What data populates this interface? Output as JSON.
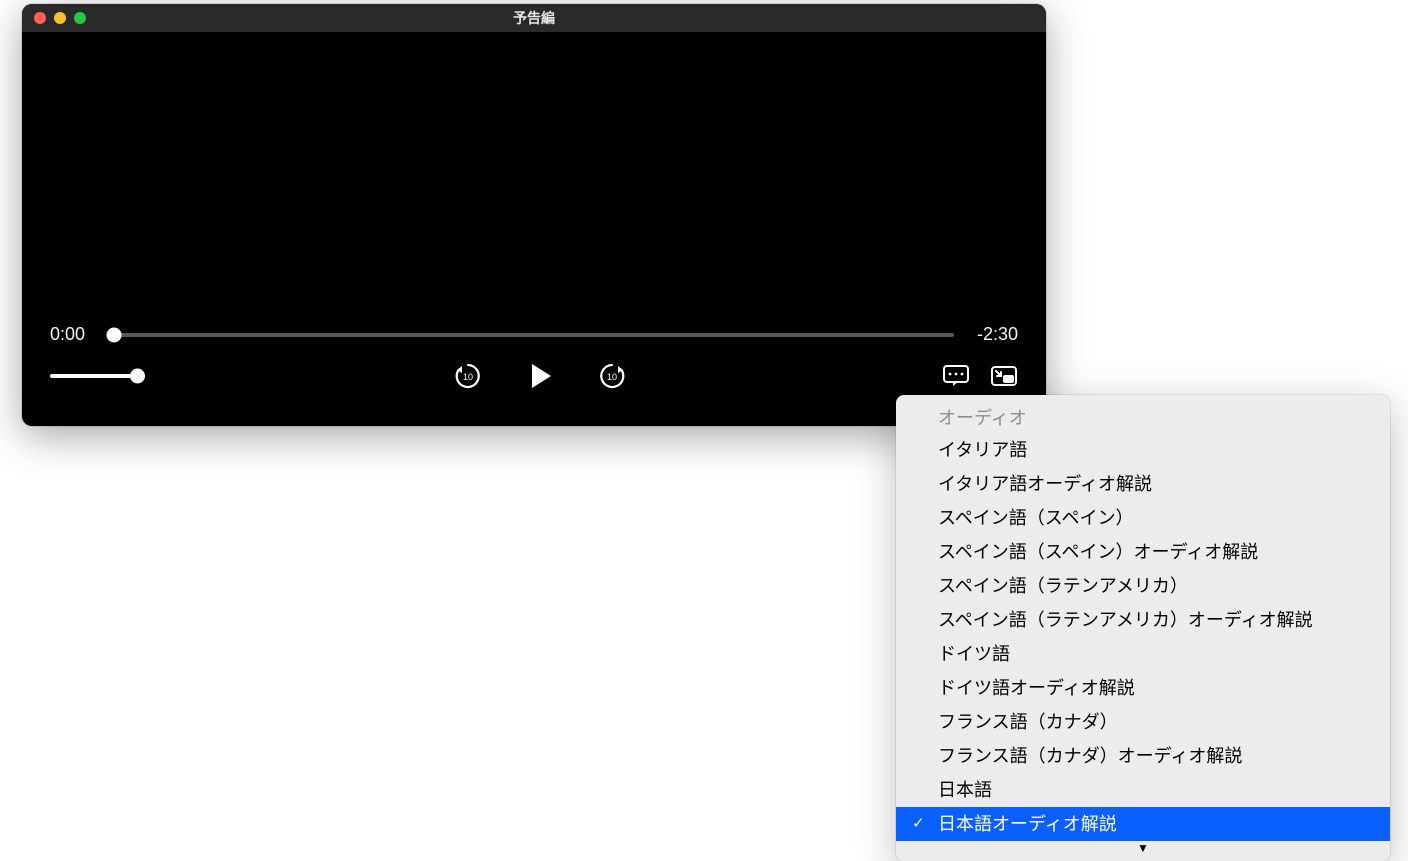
{
  "window": {
    "title": "予告編"
  },
  "playback": {
    "current_time_label": "0:00",
    "remaining_time_label": "-2:30",
    "skip_seconds": "10"
  },
  "icons": {
    "close": "close-icon",
    "minimize": "minimize-icon",
    "maximize": "maximize-icon",
    "skip_back": "skip-back-10-icon",
    "play": "play-icon",
    "skip_forward": "skip-forward-10-icon",
    "subtitles": "subtitles-icon",
    "pip": "picture-in-picture-icon",
    "scroll_more": "triangle-down-icon"
  },
  "menu": {
    "header": "オーディオ",
    "items": [
      {
        "label": "イタリア語",
        "selected": false
      },
      {
        "label": "イタリア語オーディオ解説",
        "selected": false
      },
      {
        "label": "スペイン語（スペイン）",
        "selected": false
      },
      {
        "label": "スペイン語（スペイン）オーディオ解説",
        "selected": false
      },
      {
        "label": "スペイン語（ラテンアメリカ）",
        "selected": false
      },
      {
        "label": "スペイン語（ラテンアメリカ）オーディオ解説",
        "selected": false
      },
      {
        "label": "ドイツ語",
        "selected": false
      },
      {
        "label": "ドイツ語オーディオ解説",
        "selected": false
      },
      {
        "label": "フランス語（カナダ）",
        "selected": false
      },
      {
        "label": "フランス語（カナダ）オーディオ解説",
        "selected": false
      },
      {
        "label": "日本語",
        "selected": false
      },
      {
        "label": "日本語オーディオ解説",
        "selected": true
      }
    ],
    "check_glyph": "✓",
    "more_glyph": "▼"
  }
}
